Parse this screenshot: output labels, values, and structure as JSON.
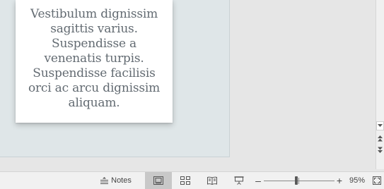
{
  "slide": {
    "body_text": "Vestibulum dignissim sagittis varius. Suspendisse a venenatis turpis. Suspendisse facilisis orci ac arcu dignissim aliquam."
  },
  "statusbar": {
    "notes_label": "Notes",
    "zoom_level": "95%",
    "zoom_fraction": 0.45,
    "views": [
      {
        "name": "normal-view-icon",
        "active": true
      },
      {
        "name": "slide-sorter-icon",
        "active": false
      },
      {
        "name": "reading-view-icon",
        "active": false
      },
      {
        "name": "slide-show-icon",
        "active": false
      }
    ],
    "icons": {
      "notes": "notes-icon",
      "zoom_out": "minus-icon",
      "zoom_in": "plus-icon",
      "fit": "fit-slide-icon"
    },
    "zoom_out_symbol": "–",
    "zoom_in_symbol": "+"
  },
  "colors": {
    "workspace_bg": "#e6e6e6",
    "slide_area_bg": "#dfe6e8",
    "text_color": "#636b72",
    "active_view_bg": "#c8c8c8"
  }
}
